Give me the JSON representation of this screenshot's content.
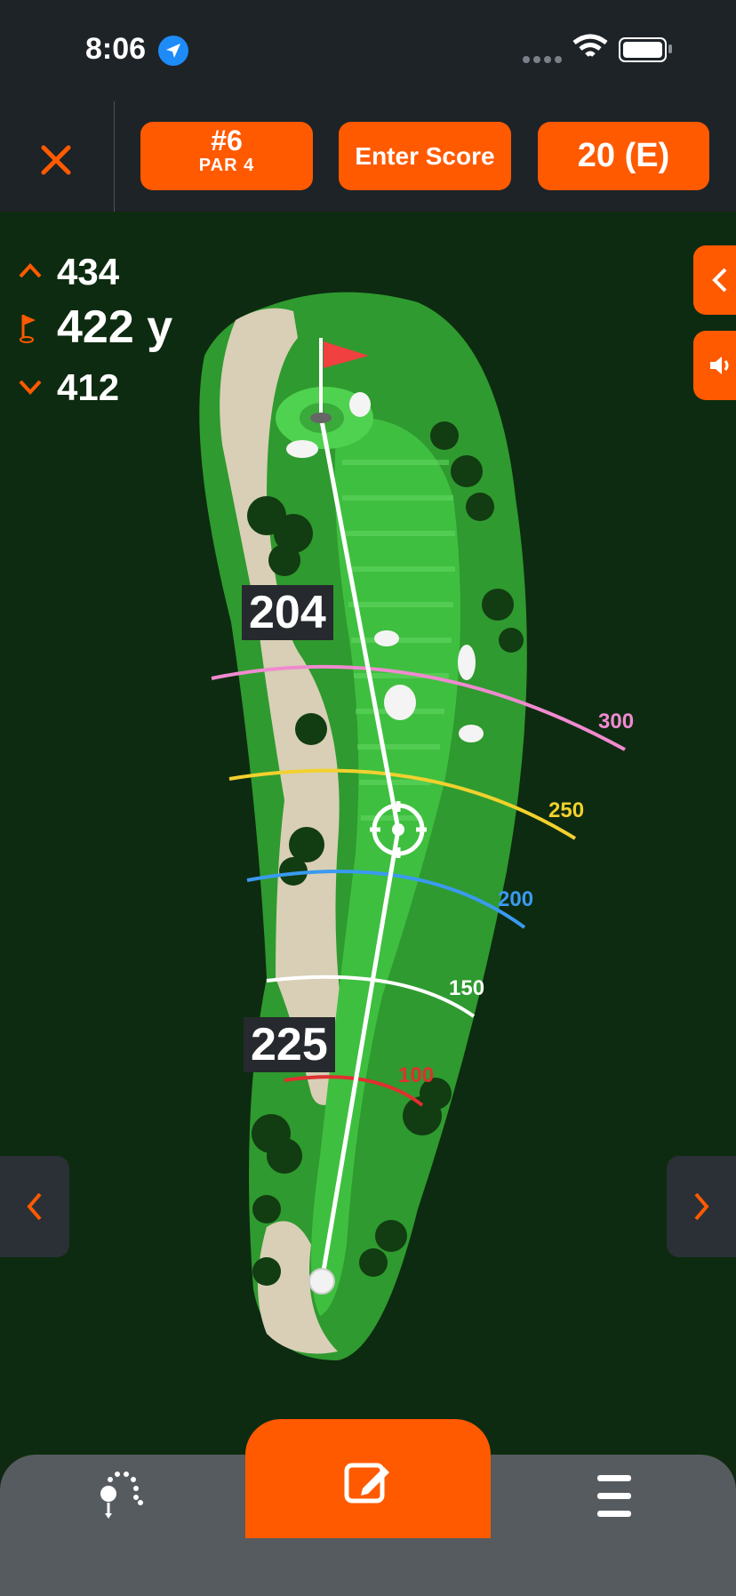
{
  "status_bar": {
    "time": "8:06"
  },
  "header": {
    "close_icon": "close-icon",
    "hole_number": "#6",
    "hole_par": "PAR 4",
    "enter_score": "Enter Score",
    "total_score": "20 (E)",
    "accent": "#ff5a00"
  },
  "distances": {
    "front": "434",
    "center": "422 y",
    "back": "412"
  },
  "map": {
    "label_top": "204",
    "label_bottom": "225",
    "arcs": [
      {
        "yards": "300",
        "color": "#f08ad0"
      },
      {
        "yards": "250",
        "color": "#f2d12e"
      },
      {
        "yards": "200",
        "color": "#3a9af0"
      },
      {
        "yards": "150",
        "color": "#ffffff"
      },
      {
        "yards": "100",
        "color": "#e03030"
      }
    ]
  },
  "side_buttons": {
    "collapse_icon": "chevron-left-icon",
    "audio_icon": "speaker-icon"
  },
  "nav": {
    "prev_icon": "chevron-left-icon",
    "next_icon": "chevron-right-icon"
  },
  "tabbar": {
    "left_icon": "shot-tracker-icon",
    "center_icon": "edit-scorecard-icon",
    "right_icon": "menu-icon"
  }
}
